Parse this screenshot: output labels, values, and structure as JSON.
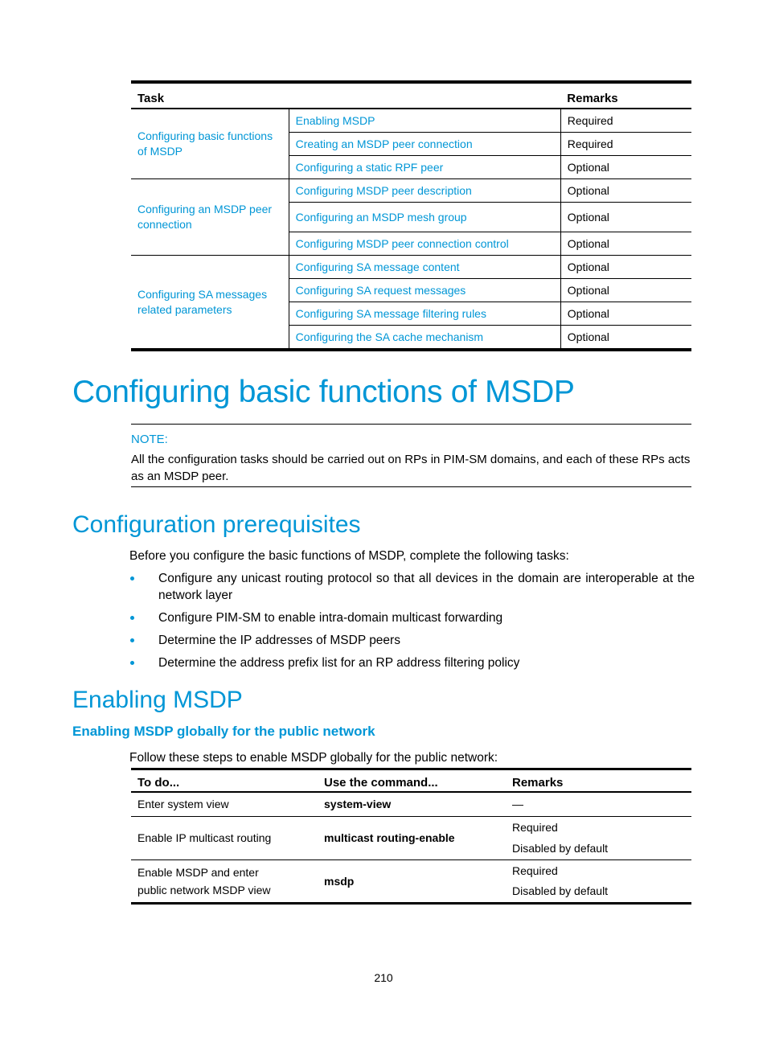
{
  "task_table": {
    "headers": {
      "task": "Task",
      "remarks": "Remarks"
    },
    "groups": [
      {
        "label": "Configuring basic functions of MSDP",
        "rows": [
          {
            "task": "Enabling MSDP",
            "remark": "Required"
          },
          {
            "task": "Creating an MSDP peer connection",
            "remark": "Required"
          },
          {
            "task": "Configuring a static RPF peer",
            "remark": "Optional"
          }
        ]
      },
      {
        "label": "Configuring an MSDP peer connection",
        "rows": [
          {
            "task": "Configuring MSDP peer description",
            "remark": "Optional"
          },
          {
            "task": "Configuring an MSDP mesh group",
            "remark": "Optional"
          },
          {
            "task": "Configuring MSDP peer connection control",
            "remark": "Optional"
          }
        ]
      },
      {
        "label": "Configuring SA messages related parameters",
        "rows": [
          {
            "task": "Configuring SA message content",
            "remark": "Optional"
          },
          {
            "task": "Configuring SA request messages",
            "remark": "Optional"
          },
          {
            "task": "Configuring SA message filtering rules",
            "remark": "Optional"
          },
          {
            "task": "Configuring the SA cache mechanism",
            "remark": "Optional"
          }
        ]
      }
    ]
  },
  "section_title": "Configuring basic functions of MSDP",
  "note": {
    "label": "NOTE:",
    "text": "All the configuration tasks should be carried out on RPs in PIM-SM domains, and each of these RPs acts as an MSDP peer."
  },
  "prerequisites": {
    "heading": "Configuration prerequisites",
    "intro": "Before you configure the basic functions of MSDP, complete the following tasks:",
    "items": [
      "Configure any unicast routing protocol so that all devices in the domain are interoperable at the network layer",
      "Configure PIM-SM to enable intra-domain multicast forwarding",
      "Determine the IP addresses of MSDP peers",
      "Determine the address prefix list for an RP address filtering policy"
    ]
  },
  "enabling": {
    "heading": "Enabling MSDP",
    "subheading": "Enabling MSDP globally for the public network",
    "intro": "Follow these steps to enable MSDP globally for the public network:",
    "table": {
      "headers": {
        "todo": "To do...",
        "command": "Use the command...",
        "remarks": "Remarks"
      },
      "rows": [
        {
          "todo": "Enter system view",
          "command": "system-view",
          "remarks": [
            "—"
          ]
        },
        {
          "todo": "Enable IP multicast routing",
          "command": "multicast routing-enable",
          "remarks": [
            "Required",
            "Disabled by default"
          ]
        },
        {
          "todo": "Enable MSDP and enter public network MSDP view",
          "command": "msdp",
          "remarks": [
            "Required",
            "Disabled by default"
          ]
        }
      ]
    }
  },
  "page_number": "210",
  "colors": {
    "accent": "#0096d6",
    "text": "#000000"
  }
}
